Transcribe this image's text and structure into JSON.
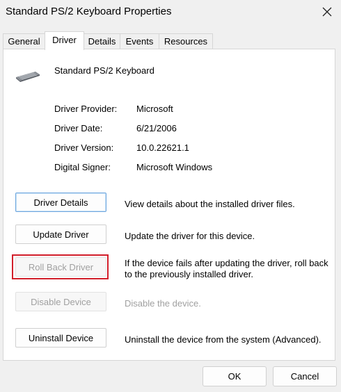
{
  "window": {
    "title": "Standard PS/2 Keyboard Properties"
  },
  "tabs": [
    {
      "label": "General",
      "active": false
    },
    {
      "label": "Driver",
      "active": true
    },
    {
      "label": "Details",
      "active": false
    },
    {
      "label": "Events",
      "active": false
    },
    {
      "label": "Resources",
      "active": false
    }
  ],
  "device": {
    "name": "Standard PS/2 Keyboard",
    "icon": "keyboard-icon"
  },
  "driver_info": [
    {
      "label": "Driver Provider:",
      "value": "Microsoft"
    },
    {
      "label": "Driver Date:",
      "value": "6/21/2006"
    },
    {
      "label": "Driver Version:",
      "value": "10.0.22621.1"
    },
    {
      "label": "Digital Signer:",
      "value": "Microsoft Windows"
    }
  ],
  "actions": [
    {
      "label": "Driver Details",
      "description": "View details about the installed driver files.",
      "enabled": true
    },
    {
      "label": "Update Driver",
      "description": "Update the driver for this device.",
      "enabled": true
    },
    {
      "label": "Roll Back Driver",
      "description": "If the device fails after updating the driver, roll back to the previously installed driver.",
      "enabled": false
    },
    {
      "label": "Disable Device",
      "description": "Disable the device.",
      "enabled": false
    },
    {
      "label": "Uninstall Device",
      "description": "Uninstall the device from the system (Advanced).",
      "enabled": true
    }
  ],
  "footer": {
    "ok_label": "OK",
    "cancel_label": "Cancel"
  },
  "colors": {
    "highlight": "#d21e2a",
    "focus_border": "#6ea6de",
    "disabled_text": "#a0a0a0"
  }
}
